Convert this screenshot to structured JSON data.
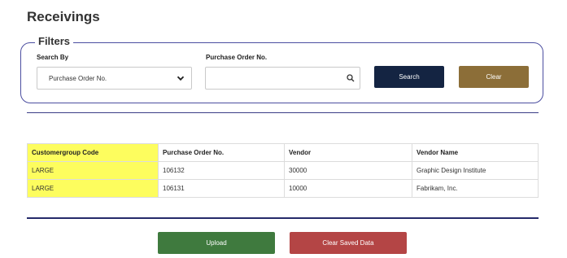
{
  "page": {
    "title": "Receivings"
  },
  "filters": {
    "legend": "Filters",
    "search_by_label": "Search By",
    "search_by_value": "Purchase Order No.",
    "po_label": "Purchase Order No.",
    "po_value": "",
    "search_button": "Search",
    "clear_button": "Clear"
  },
  "table": {
    "headers": [
      "Customergroup Code",
      "Purchase Order No.",
      "Vendor",
      "Vendor Name"
    ],
    "rows": [
      [
        "LARGE",
        "106132",
        "30000",
        "Graphic Design Institute"
      ],
      [
        "LARGE",
        "106131",
        "10000",
        "Fabrikam, Inc."
      ]
    ]
  },
  "actions": {
    "upload": "Upload",
    "clear_saved": "Clear Saved Data"
  },
  "colors": {
    "accent": "#4b4ea0",
    "search_button": "#142442",
    "clear_button": "#8c6e38",
    "upload_button": "#3f7a3e",
    "clear_saved_button": "#b44545",
    "highlight": "#fdfd5e"
  },
  "icons": {
    "select_chevron": "chevron-down-icon",
    "input_search": "search-icon"
  }
}
